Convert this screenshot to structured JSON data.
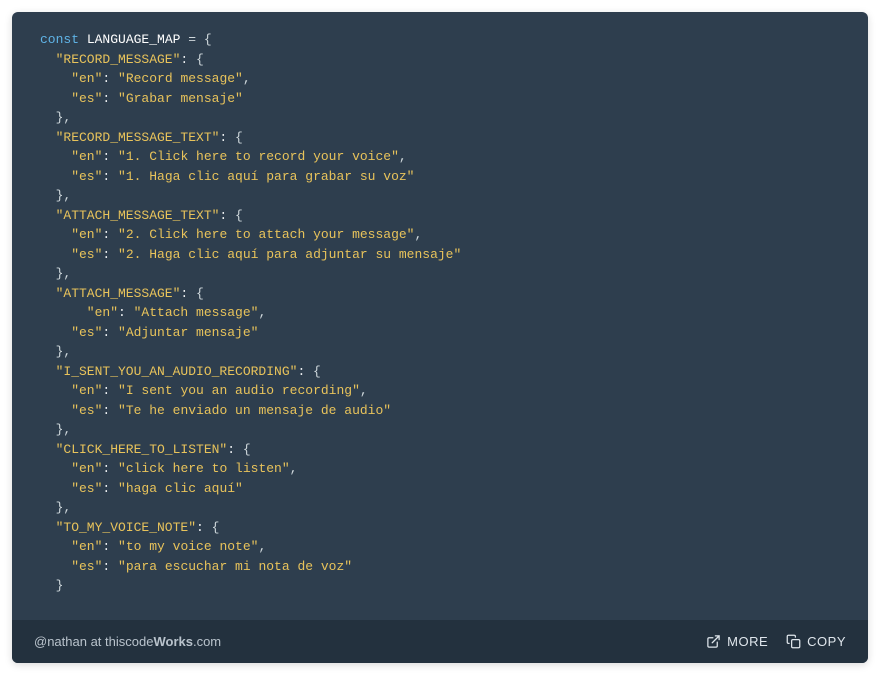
{
  "code": {
    "keyword": "const",
    "identifier": "LANGUAGE_MAP",
    "equals": "=",
    "open": "{",
    "close": "}",
    "colon": ":",
    "comma": ",",
    "entries": [
      {
        "key": "\"RECORD_MESSAGE\"",
        "en_k": "\"en\"",
        "en_v": "\"Record message\"",
        "es_k": "\"es\"",
        "es_v": "\"Grabar mensaje\"",
        "extra_indent_en": false
      },
      {
        "key": "\"RECORD_MESSAGE_TEXT\"",
        "en_k": "\"en\"",
        "en_v": "\"1. Click here to record your voice\"",
        "es_k": "\"es\"",
        "es_v": "\"1. Haga clic aquí para grabar su voz\"",
        "extra_indent_en": false
      },
      {
        "key": "\"ATTACH_MESSAGE_TEXT\"",
        "en_k": "\"en\"",
        "en_v": "\"2. Click here to attach your message\"",
        "es_k": "\"es\"",
        "es_v": "\"2. Haga clic aquí para adjuntar su mensaje\"",
        "extra_indent_en": false
      },
      {
        "key": "\"ATTACH_MESSAGE\"",
        "en_k": "\"en\"",
        "en_v": "\"Attach message\"",
        "es_k": "\"es\"",
        "es_v": "\"Adjuntar mensaje\"",
        "extra_indent_en": true
      },
      {
        "key": "\"I_SENT_YOU_AN_AUDIO_RECORDING\"",
        "en_k": "\"en\"",
        "en_v": "\"I sent you an audio recording\"",
        "es_k": "\"es\"",
        "es_v": "\"Te he enviado un mensaje de audio\"",
        "extra_indent_en": false
      },
      {
        "key": "\"CLICK_HERE_TO_LISTEN\"",
        "en_k": "\"en\"",
        "en_v": "\"click here to listen\"",
        "es_k": "\"es\"",
        "es_v": "\"haga clic aquí\"",
        "extra_indent_en": false
      },
      {
        "key": "\"TO_MY_VOICE_NOTE\"",
        "en_k": "\"en\"",
        "en_v": "\"to my voice note\"",
        "es_k": "\"es\"",
        "es_v": "\"para escuchar mi nota de voz\"",
        "extra_indent_en": false
      }
    ]
  },
  "footer": {
    "handle": "@nathan",
    "at": " at ",
    "site_prefix": "thiscode",
    "site_bold": "Works",
    "site_suffix": ".com",
    "more_label": "MORE",
    "copy_label": "COPY"
  }
}
